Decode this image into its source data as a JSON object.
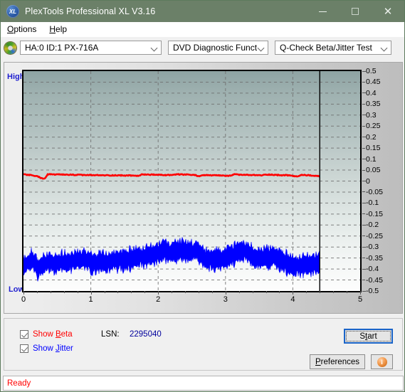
{
  "window": {
    "title": "PlexTools Professional XL V3.16",
    "app_icon": "xl-logo-icon",
    "minimize_label": "Minimize",
    "maximize_label": "Maximize",
    "close_label": "Close"
  },
  "menubar": {
    "items": [
      {
        "label": "Options",
        "accel": "O"
      },
      {
        "label": "Help",
        "accel": "H"
      }
    ]
  },
  "toolbar": {
    "drive_icon": "optical-disc-icon",
    "drive": "HA:0 ID:1  PX-716A",
    "function": "DVD Diagnostic Functions",
    "test": "Q-Check Beta/Jitter Test"
  },
  "chart_data": {
    "type": "line",
    "title": "Q-Check Beta/Jitter Test",
    "xlabel": "",
    "ylabel": "",
    "xlim": [
      0,
      5
    ],
    "ylim": [
      -0.5,
      0.5
    ],
    "grid": true,
    "x_ticks": [
      "0",
      "1",
      "2",
      "3",
      "4",
      "5"
    ],
    "y_ticks": [
      "0.5",
      "0.45",
      "0.4",
      "0.35",
      "0.3",
      "0.25",
      "0.2",
      "0.15",
      "0.1",
      "0.05",
      "0",
      "-0.05",
      "-0.1",
      "-0.15",
      "-0.2",
      "-0.25",
      "-0.3",
      "-0.35",
      "-0.4",
      "-0.45",
      "-0.5"
    ],
    "left_axis_top_label": "High",
    "left_axis_bottom_label": "Low",
    "data_end_x": 4.4,
    "series": [
      {
        "name": "Beta",
        "color": "#ff0000",
        "x": [
          0.0,
          0.1,
          0.2,
          0.28,
          0.32,
          0.36,
          0.45,
          0.6,
          0.8,
          1.0,
          1.2,
          1.4,
          1.6,
          1.72,
          1.76,
          1.9,
          2.05,
          2.15,
          2.3,
          2.45,
          2.55,
          2.6,
          2.66,
          2.8,
          2.95,
          3.05,
          3.12,
          3.18,
          3.3,
          3.45,
          3.55,
          3.6,
          3.68,
          3.8,
          3.95,
          4.08,
          4.12,
          4.2,
          4.3,
          4.4
        ],
        "y": [
          0.03,
          0.027,
          0.022,
          0.012,
          0.012,
          0.031,
          0.03,
          0.029,
          0.028,
          0.027,
          0.026,
          0.026,
          0.025,
          0.024,
          0.03,
          0.029,
          0.028,
          0.027,
          0.03,
          0.029,
          0.027,
          0.022,
          0.027,
          0.026,
          0.025,
          0.023,
          0.03,
          0.029,
          0.028,
          0.027,
          0.026,
          0.03,
          0.029,
          0.027,
          0.026,
          0.02,
          0.028,
          0.027,
          0.024,
          0.022
        ]
      },
      {
        "name": "Jitter",
        "color": "#0000ff",
        "description": "Noisy band; values are the band centre in plot units",
        "x": [
          0.0,
          0.12,
          0.22,
          0.33,
          0.45,
          0.6,
          0.75,
          0.9,
          1.02,
          1.15,
          1.35,
          1.55,
          1.75,
          1.95,
          2.1,
          2.2,
          2.28,
          2.4,
          2.48,
          2.58,
          2.7,
          2.8,
          2.95,
          3.08,
          3.2,
          3.32,
          3.45,
          3.55,
          3.62,
          3.75,
          3.9,
          4.02,
          4.1,
          4.22,
          4.32,
          4.4
        ],
        "y": [
          -0.385,
          -0.36,
          -0.395,
          -0.37,
          -0.372,
          -0.368,
          -0.362,
          -0.355,
          -0.372,
          -0.368,
          -0.362,
          -0.355,
          -0.345,
          -0.33,
          -0.315,
          -0.33,
          -0.318,
          -0.315,
          -0.318,
          -0.32,
          -0.358,
          -0.356,
          -0.352,
          -0.34,
          -0.322,
          -0.318,
          -0.352,
          -0.35,
          -0.348,
          -0.345,
          -0.37,
          -0.392,
          -0.382,
          -0.378,
          -0.375,
          -0.372
        ]
      }
    ]
  },
  "controls": {
    "show_beta": {
      "label_prefix": "Show ",
      "accel": "B",
      "label_rest": "eta",
      "checked": true,
      "color": "#ff0000"
    },
    "show_jitter": {
      "label_prefix": "Show ",
      "accel": "J",
      "label_rest": "itter",
      "checked": true,
      "color": "#0000ff"
    },
    "lsn_label": "LSN:",
    "lsn_value": "2295040",
    "start": {
      "prefix": "S",
      "accel": "t",
      "rest": "art",
      "label": "Start",
      "focused": true
    },
    "preferences": {
      "prefix": "",
      "accel": "P",
      "rest": "references",
      "label": "Preferences"
    },
    "info_icon": "info-icon",
    "info_glyph": "i"
  },
  "statusbar": {
    "text": "Ready",
    "color": "#ff0000"
  }
}
